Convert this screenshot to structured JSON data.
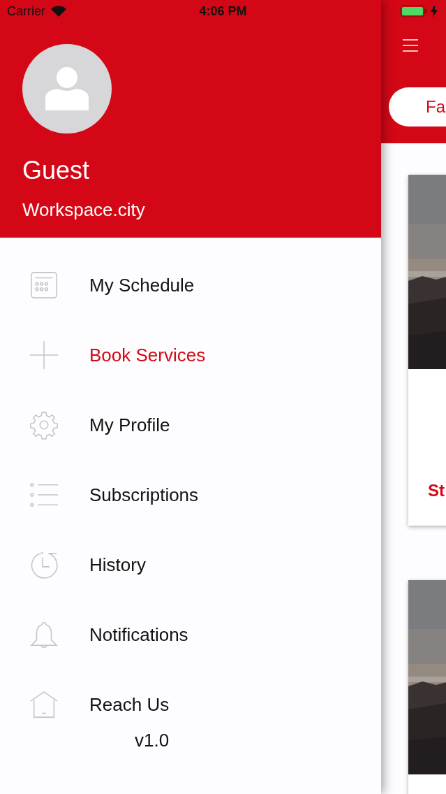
{
  "status_bar": {
    "carrier": "Carrier",
    "time": "4:06 PM"
  },
  "drawer": {
    "profile": {
      "name": "Guest",
      "subtitle": "Workspace.city"
    },
    "items": [
      {
        "label": "My Schedule",
        "kind": "calendar",
        "selected": false
      },
      {
        "label": "Book Services",
        "kind": "plus",
        "selected": true
      },
      {
        "label": "My Profile",
        "kind": "gear",
        "selected": false
      },
      {
        "label": "Subscriptions",
        "kind": "list",
        "selected": false
      },
      {
        "label": "History",
        "kind": "history",
        "selected": false
      },
      {
        "label": "Notifications",
        "kind": "bell",
        "selected": false
      },
      {
        "label": "Reach Us",
        "kind": "house",
        "selected": false
      }
    ],
    "version": "v1.0"
  },
  "main": {
    "filter_button": "Fa",
    "cards": [
      {
        "kind": "picture",
        "title": "St"
      },
      {
        "kind": "picture"
      }
    ]
  }
}
